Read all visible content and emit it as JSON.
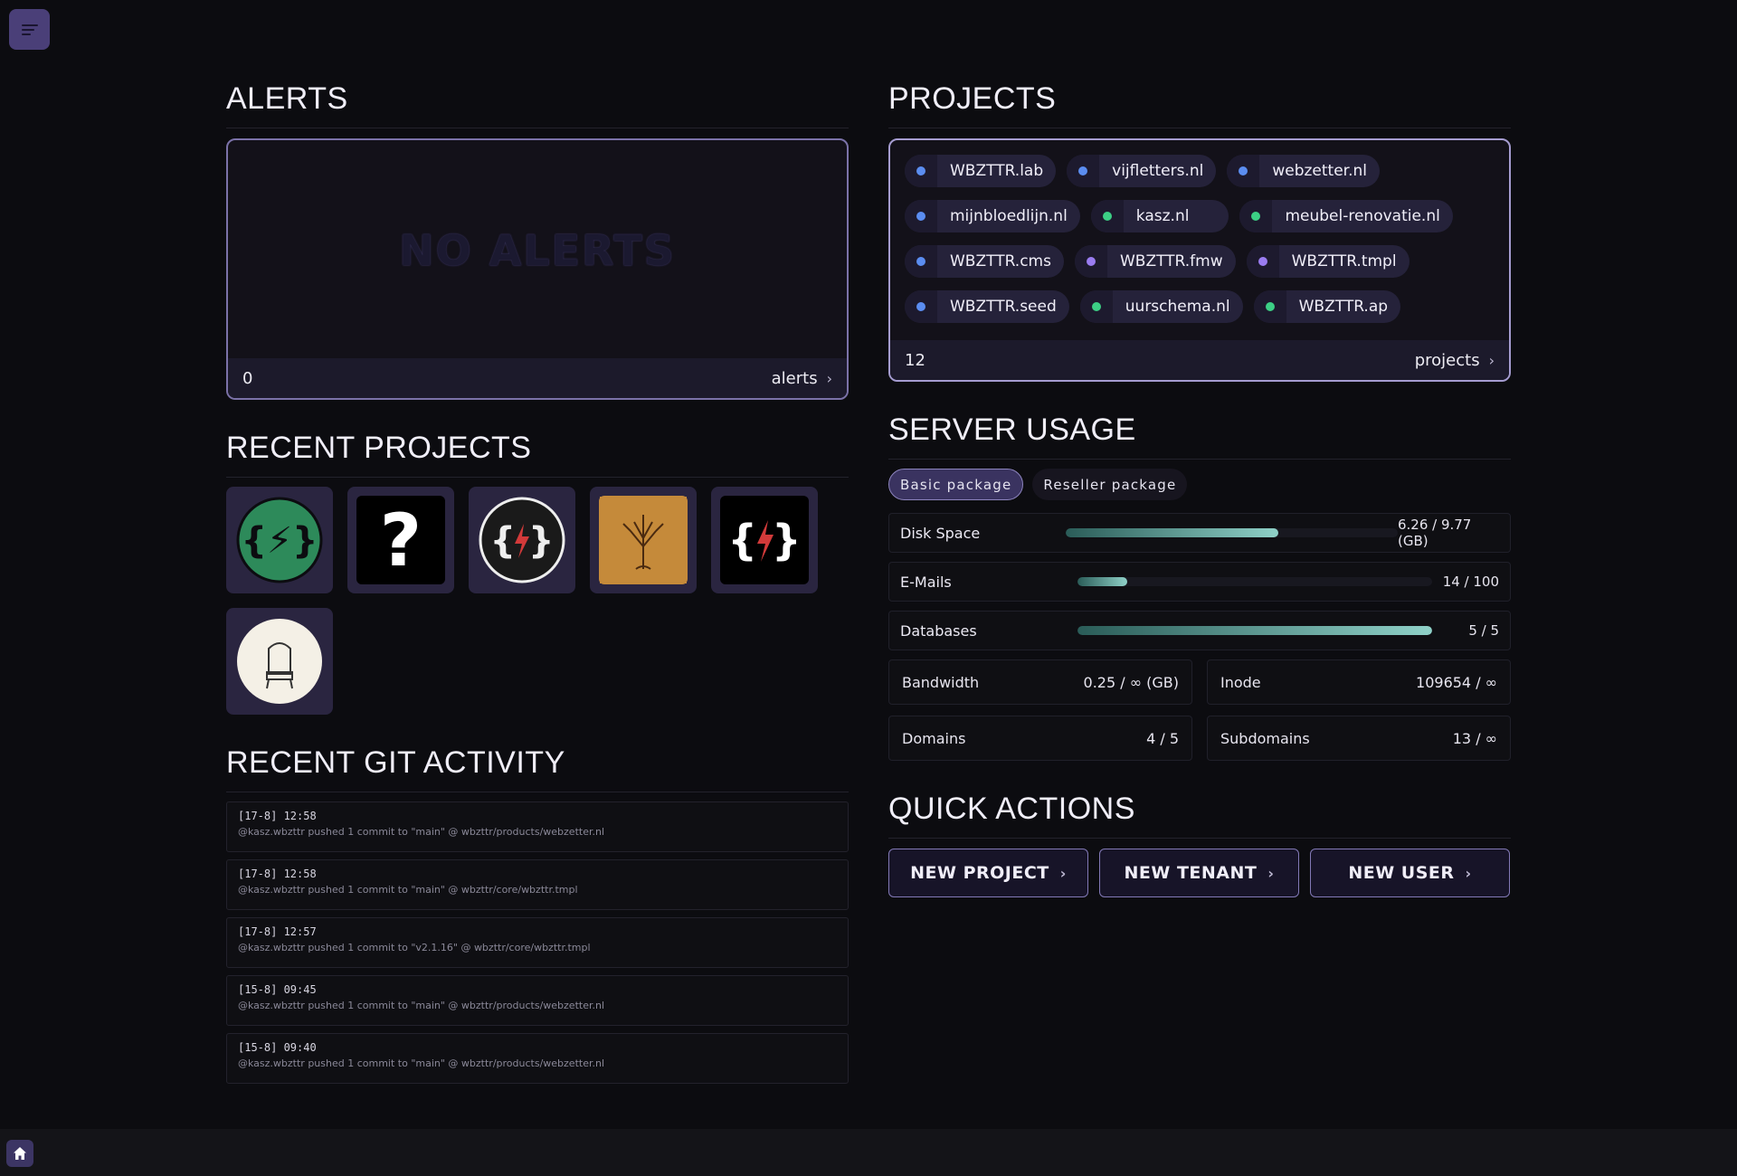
{
  "alerts": {
    "title": "ALERTS",
    "empty_text": "NO ALERTS",
    "count": "0",
    "link": "alerts"
  },
  "recent_projects": {
    "title": "RECENT PROJECTS",
    "items": [
      {
        "name": "wbzttr-green-logo",
        "bg": "#2d8a5a"
      },
      {
        "name": "unknown-logo",
        "bg": "#000000"
      },
      {
        "name": "wbzttr-dark-logo",
        "bg": "#1a1a1a"
      },
      {
        "name": "tree-logo",
        "bg": "#c58a3a"
      },
      {
        "name": "wbzttr-black-logo",
        "bg": "#000000"
      },
      {
        "name": "meubel-renovatie-logo",
        "bg": "#f4f0e6"
      }
    ]
  },
  "git": {
    "title": "RECENT GIT ACTIVITY",
    "items": [
      {
        "time": "[17-8] 12:58",
        "msg": "@kasz.wbzttr pushed 1 commit to \"main\" @ wbzttr/products/webzetter.nl"
      },
      {
        "time": "[17-8] 12:58",
        "msg": "@kasz.wbzttr pushed 1 commit to \"main\" @ wbzttr/core/wbzttr.tmpl"
      },
      {
        "time": "[17-8] 12:57",
        "msg": "@kasz.wbzttr pushed 1 commit to \"v2.1.16\" @ wbzttr/core/wbzttr.tmpl"
      },
      {
        "time": "[15-8] 09:45",
        "msg": "@kasz.wbzttr pushed 1 commit to \"main\" @ wbzttr/products/webzetter.nl"
      },
      {
        "time": "[15-8] 09:40",
        "msg": "@kasz.wbzttr pushed 1 commit to \"main\" @ wbzttr/products/webzetter.nl"
      }
    ]
  },
  "projects": {
    "title": "PROJECTS",
    "count": "12",
    "link": "projects",
    "rows": [
      [
        {
          "label": "WBZTTR.lab",
          "color": "#5b8df0"
        },
        {
          "label": "vijfletters.nl",
          "color": "#5b8df0"
        },
        {
          "label": "webzetter.nl",
          "color": "#5b8df0"
        }
      ],
      [
        {
          "label": "mijnbloedlijn.nl",
          "color": "#5b8df0"
        },
        {
          "label": "kasz.nl",
          "color": "#3ccf85"
        },
        {
          "label": "meubel-renovatie.nl",
          "color": "#3ccf85"
        }
      ],
      [
        {
          "label": "WBZTTR.cms",
          "color": "#5b8df0"
        },
        {
          "label": "WBZTTR.fmw",
          "color": "#9a7cf0"
        },
        {
          "label": "WBZTTR.tmpl",
          "color": "#9a7cf0"
        }
      ],
      [
        {
          "label": "WBZTTR.seed",
          "color": "#5b8df0"
        },
        {
          "label": "uurschema.nl",
          "color": "#3ccf85"
        },
        {
          "label": "WBZTTR.ap",
          "color": "#3ccf85"
        }
      ]
    ]
  },
  "server": {
    "title": "SERVER USAGE",
    "tabs": [
      "Basic package",
      "Reseller package"
    ],
    "bars": [
      {
        "label": "Disk Space",
        "value": "6.26 / 9.77 (GB)",
        "fraction": 0.64
      },
      {
        "label": "E-Mails",
        "value": "14 / 100",
        "fraction": 0.14
      },
      {
        "label": "Databases",
        "value": "5 / 5",
        "fraction": 1.0
      }
    ],
    "stats": [
      {
        "label": "Bandwidth",
        "value": "0.25 / ∞ (GB)"
      },
      {
        "label": "Inode",
        "value": "109654 / ∞"
      },
      {
        "label": "Domains",
        "value": "4 / 5"
      },
      {
        "label": "Subdomains",
        "value": "13 / ∞"
      }
    ]
  },
  "quick": {
    "title": "QUICK ACTIONS",
    "buttons": [
      "NEW PROJECT",
      "NEW TENANT",
      "NEW USER"
    ]
  }
}
